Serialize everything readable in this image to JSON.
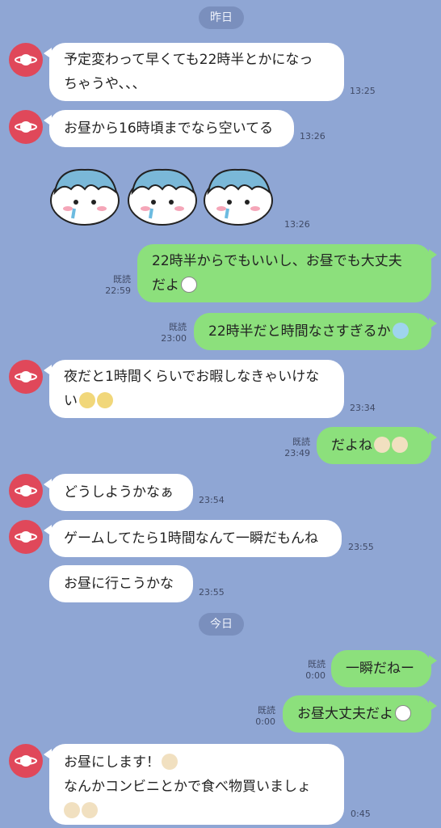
{
  "dates": {
    "yesterday": "昨日",
    "today": "今日"
  },
  "messages": [
    {
      "line1": "予定変わって早くても22時半とかになっ",
      "line2": "ちゃうや､､､",
      "time": "13:25"
    },
    {
      "text": "お昼から16時頃までなら空いてる",
      "time": "13:26"
    },
    {
      "sticker": "crying-character-sticker",
      "time": "13:26"
    },
    {
      "line1": "22時半からでもいいし、お昼でも大丈夫",
      "line2": "だよ",
      "read": "既読",
      "time": "22:59"
    },
    {
      "text": "22時半だと時間なさすぎるか",
      "read": "既読",
      "time": "23:00"
    },
    {
      "line1": "夜だと1時間くらいでお暇しなきゃいけな",
      "line2": "い",
      "time": "23:34"
    },
    {
      "text": "だよね",
      "read": "既読",
      "time": "23:49"
    },
    {
      "text": "どうしようかなぁ",
      "time": "23:54"
    },
    {
      "text": "ゲームしてたら1時間なんて一瞬だもんね",
      "time": "23:55"
    },
    {
      "text": "お昼に行こうかな",
      "time": "23:55"
    },
    {
      "text": "一瞬だねー",
      "read": "既読",
      "time": "0:00"
    },
    {
      "text": "お昼大丈夫だよ",
      "read": "既読",
      "time": "0:00"
    },
    {
      "line1": "お昼にします！",
      "line2": "なんかコンビニとかで食べ物買いましょ",
      "time": "0:45"
    }
  ],
  "colors": {
    "background": "#8fa6d4",
    "incoming": "#ffffff",
    "outgoing": "#8ce07c",
    "avatar": "#e0485a"
  }
}
